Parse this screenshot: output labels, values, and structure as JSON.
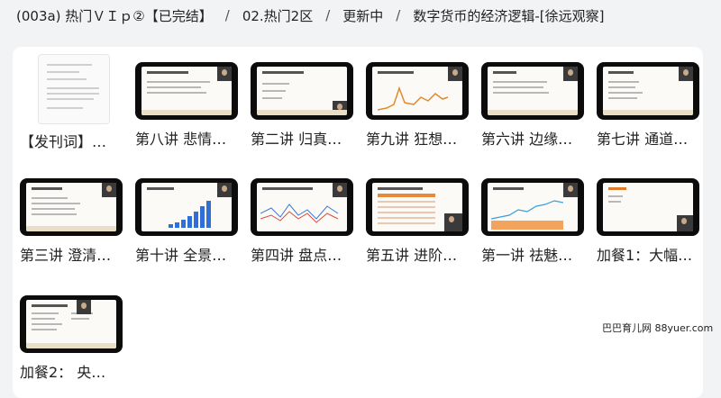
{
  "breadcrumb": {
    "items": [
      "(003a)  热门ＶＩｐ②【已完结】",
      "02.热门2区",
      "更新中",
      "数字货币的经济逻辑-[徐远观察]"
    ],
    "separator": "/"
  },
  "files": [
    {
      "caption": "【发刊词】…",
      "thumb": "document"
    },
    {
      "caption": "第八讲 悲情…",
      "thumb": "slide"
    },
    {
      "caption": "第二讲 归真…",
      "thumb": "slide"
    },
    {
      "caption": "第九讲 狂想…",
      "thumb": "line-chart-slide"
    },
    {
      "caption": "第六讲 边缘…",
      "thumb": "slide"
    },
    {
      "caption": "第七讲 通道…",
      "thumb": "slide"
    },
    {
      "caption": "第三讲 澄清…",
      "thumb": "slide"
    },
    {
      "caption": "第十讲 全景…",
      "thumb": "bar-chart-slide"
    },
    {
      "caption": "第四讲 盘点…",
      "thumb": "line-chart-slide"
    },
    {
      "caption": "第五讲 进阶…",
      "thumb": "table-slide"
    },
    {
      "caption": "第一讲 祛魅…",
      "thumb": "chart-slide"
    },
    {
      "caption": "加餐1：大幅…",
      "thumb": "slide"
    },
    {
      "caption": "加餐2： 央…",
      "thumb": "slide"
    }
  ],
  "watermark": "巴巴育儿网  88yuer.com"
}
